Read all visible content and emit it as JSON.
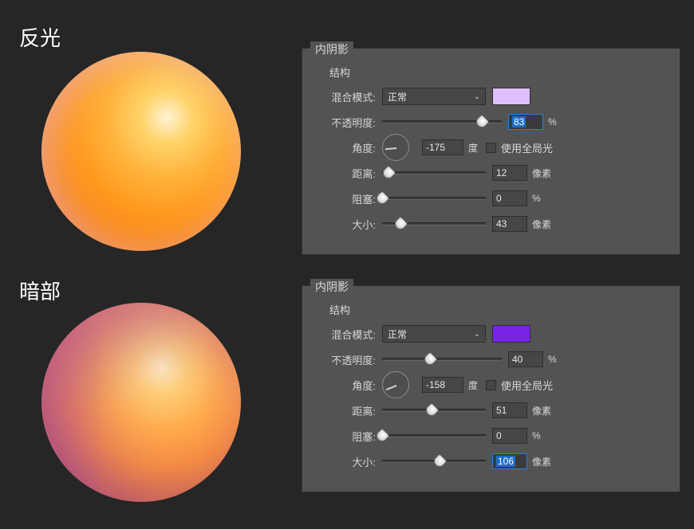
{
  "labels": {
    "reflection": "反光",
    "shadow": "暗部"
  },
  "panelTitle": "内阴影",
  "panelSubtitle": "结构",
  "fields": {
    "blendMode": "混合模式:",
    "opacity": "不透明度:",
    "angle": "角度:",
    "distance": "距离:",
    "choke": "阻塞:",
    "size": "大小:",
    "globalLight": "使用全局光"
  },
  "units": {
    "percent": "%",
    "degree": "度",
    "pixel": "像素"
  },
  "panel1": {
    "blendMode": "正常",
    "color": "#dfbeff",
    "colorSwatch": "#dfbeff",
    "opacity": "83",
    "angle": "-175",
    "globalLight": false,
    "distance": "12",
    "choke": "0",
    "size": "43"
  },
  "panel2": {
    "blendMode": "正常",
    "color": "#7824e8",
    "colorSwatch": "#7824e8",
    "opacity": "40",
    "angle": "-158",
    "globalLight": false,
    "distance": "51",
    "choke": "0",
    "size": "106"
  }
}
